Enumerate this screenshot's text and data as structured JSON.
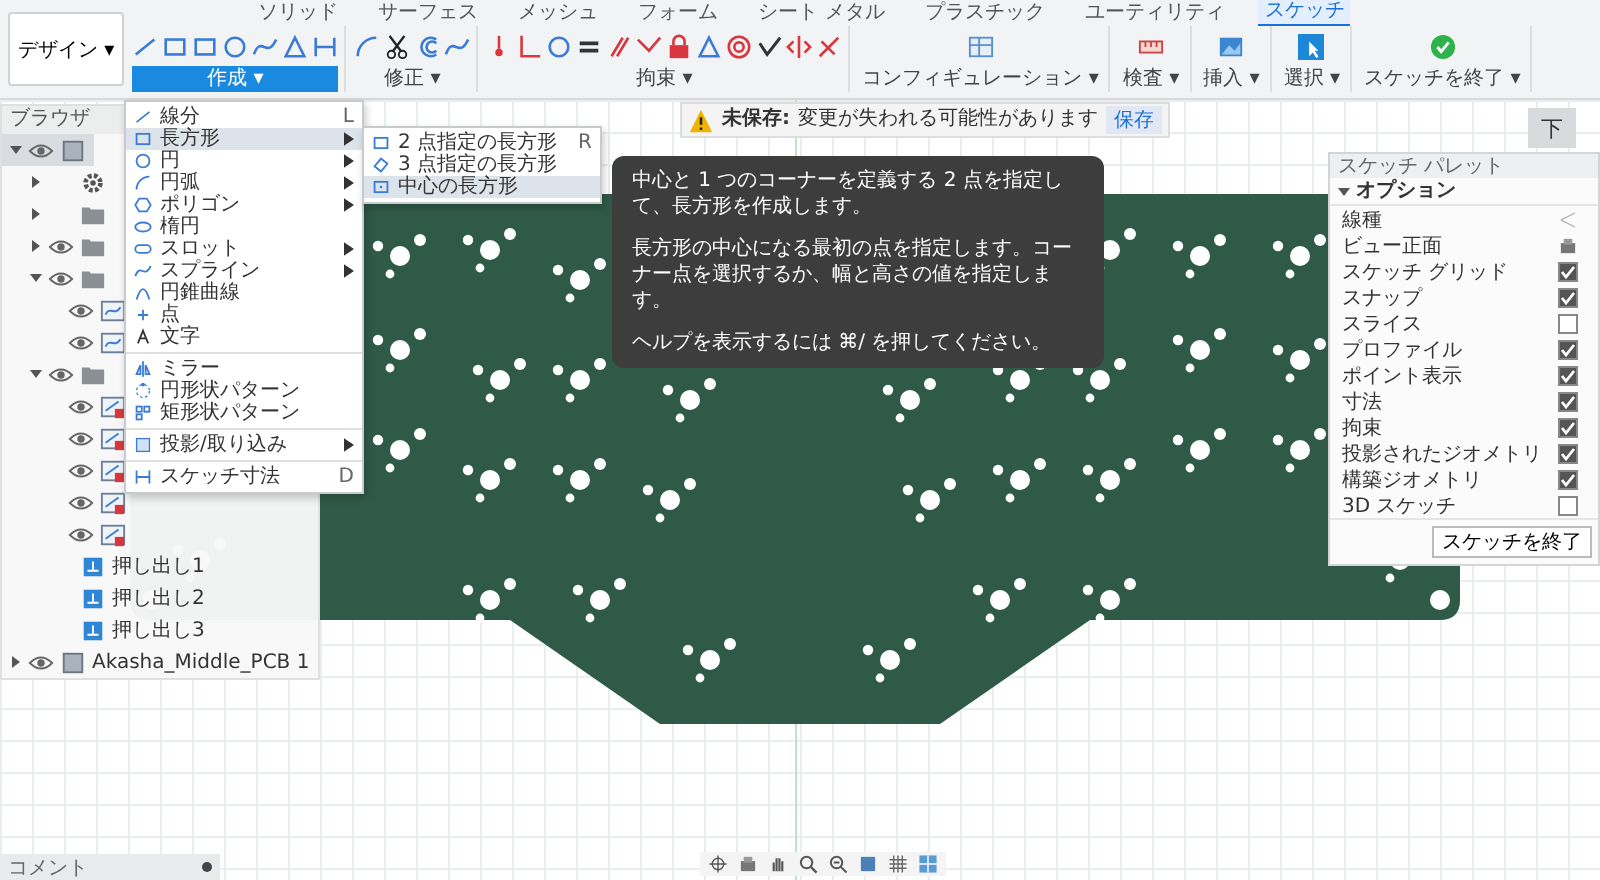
{
  "workspace_button": "デザイン ▾",
  "tabs": [
    {
      "label": "ソリッド",
      "selected": false
    },
    {
      "label": "サーフェス",
      "selected": false
    },
    {
      "label": "メッシュ",
      "selected": false
    },
    {
      "label": "フォーム",
      "selected": false
    },
    {
      "label": "シート メタル",
      "selected": false
    },
    {
      "label": "プラスチック",
      "selected": false
    },
    {
      "label": "ユーティリティ",
      "selected": false
    },
    {
      "label": "スケッチ",
      "selected": true
    }
  ],
  "groups": [
    {
      "label": "作成 ▾",
      "open": true,
      "tools": [
        {
          "kind": "line"
        },
        {
          "kind": "rectangle"
        },
        {
          "kind": "rectangle"
        },
        {
          "kind": "circle"
        },
        {
          "kind": "spline"
        },
        {
          "kind": "triangle"
        },
        {
          "kind": "dimension"
        }
      ]
    },
    {
      "label": "修正 ▾",
      "open": false,
      "tools": [
        {
          "kind": "arc"
        },
        {
          "kind": "scissors"
        },
        {
          "kind": "offset"
        },
        {
          "kind": "spline"
        }
      ]
    },
    {
      "label": "拘束 ▾",
      "open": false,
      "tools": [
        {
          "kind": "coincident"
        },
        {
          "kind": "perpendicular"
        },
        {
          "kind": "circle"
        },
        {
          "kind": "equal"
        },
        {
          "kind": "parallel"
        },
        {
          "kind": "tangent"
        },
        {
          "kind": "lock"
        },
        {
          "kind": "triangle"
        },
        {
          "kind": "concentric"
        },
        {
          "kind": "fix"
        },
        {
          "kind": "symmetric"
        },
        {
          "kind": "curvature"
        }
      ]
    },
    {
      "label": "コンフィギュレーション ▾",
      "open": false,
      "tools": [
        {
          "kind": "config"
        }
      ]
    },
    {
      "label": "検査 ▾",
      "open": false,
      "tools": [
        {
          "kind": "inspect"
        }
      ]
    },
    {
      "label": "挿入 ▾",
      "open": false,
      "tools": [
        {
          "kind": "insert"
        }
      ]
    },
    {
      "label": "選択 ▾",
      "open": false,
      "tools": [
        {
          "kind": "select"
        }
      ]
    },
    {
      "label": "スケッチを終了 ▾",
      "open": false,
      "tools": [
        {
          "kind": "finish"
        }
      ]
    }
  ],
  "notice": {
    "label": "未保存:",
    "text": "変更が失われる可能性があります",
    "button": "保存"
  },
  "browser": {
    "title": "ブラウザ",
    "items": [
      {
        "kind": "component",
        "visible": true,
        "expanded": true,
        "selected": true,
        "children": [
          {
            "kind": "gear",
            "visible": false,
            "expanded": false,
            "selected": false
          },
          {
            "kind": "folder",
            "visible": false,
            "expanded": false,
            "selected": false
          },
          {
            "kind": "folder",
            "visible": true,
            "expanded": false,
            "selected": false
          },
          {
            "kind": "folder",
            "visible": true,
            "expanded": true,
            "selected": false,
            "children": [
              {
                "kind": "sketch",
                "visible": true,
                "selected": false
              },
              {
                "kind": "sketch",
                "visible": true,
                "selected": false
              }
            ]
          },
          {
            "kind": "folder",
            "visible": true,
            "expanded": true,
            "selected": false,
            "children": [
              {
                "kind": "sketch-warning",
                "visible": true,
                "selected": false
              },
              {
                "kind": "sketch-warning",
                "visible": true,
                "selected": false
              },
              {
                "kind": "sketch-warning",
                "visible": true,
                "selected": false
              },
              {
                "kind": "sketch-warning",
                "visible": true,
                "selected": false
              },
              {
                "kind": "sketch-warning",
                "visible": true,
                "selected": false
              }
            ]
          },
          {
            "kind": "extrude",
            "label": "押し出し1",
            "visible": false,
            "selected": false
          },
          {
            "kind": "extrude",
            "label": "押し出し2",
            "visible": false,
            "selected": false
          },
          {
            "kind": "extrude",
            "label": "押し出し3",
            "visible": false,
            "selected": false
          }
        ]
      },
      {
        "kind": "component",
        "label": "Akasha_Middle_PCB 1",
        "visible": true,
        "expanded": false,
        "selected": false
      }
    ]
  },
  "create_menu": [
    [
      {
        "kind": "line",
        "label": "線分",
        "shortcut": "L",
        "submenu": false,
        "highlighted": false
      },
      {
        "kind": "rectangle",
        "label": "長方形",
        "submenu": true,
        "highlighted": true
      },
      {
        "kind": "circle",
        "label": "円",
        "submenu": true,
        "highlighted": false
      },
      {
        "kind": "arc",
        "label": "円弧",
        "submenu": true,
        "highlighted": false
      },
      {
        "kind": "polygon",
        "label": "ポリゴン",
        "submenu": true,
        "highlighted": false
      },
      {
        "kind": "ellipse",
        "label": "楕円",
        "submenu": false,
        "highlighted": false
      },
      {
        "kind": "slot",
        "label": "スロット",
        "submenu": true,
        "highlighted": false
      },
      {
        "kind": "spline",
        "label": "スプライン",
        "submenu": true,
        "highlighted": false
      },
      {
        "kind": "conic",
        "label": "円錐曲線",
        "submenu": false,
        "highlighted": false
      },
      {
        "kind": "point",
        "label": "点",
        "submenu": false,
        "highlighted": false
      },
      {
        "kind": "text",
        "label": "文字",
        "submenu": false,
        "highlighted": false
      }
    ],
    [
      {
        "kind": "mirror",
        "label": "ミラー",
        "submenu": false,
        "highlighted": false
      },
      {
        "kind": "circular-pattern",
        "label": "円形状パターン",
        "submenu": false,
        "highlighted": false
      },
      {
        "kind": "rect-pattern",
        "label": "矩形状パターン",
        "submenu": false,
        "highlighted": false
      }
    ],
    [
      {
        "kind": "project",
        "label": "投影/取り込み",
        "submenu": true,
        "highlighted": false
      }
    ],
    [
      {
        "kind": "dimension",
        "label": "スケッチ寸法",
        "shortcut": "D",
        "submenu": false,
        "highlighted": false
      }
    ]
  ],
  "rectangle_submenu": [
    {
      "kind": "rectangle",
      "label": "2 点指定の長方形",
      "shortcut": "R",
      "highlighted": false
    },
    {
      "kind": "rect-3pt",
      "label": "3 点指定の長方形",
      "highlighted": false
    },
    {
      "kind": "rect-center",
      "label": "中心の長方形",
      "highlighted": true
    }
  ],
  "tooltip": {
    "paragraphs": [
      "中心と 1 つのコーナーを定義する 2 点を指定して、長方形を作成します。",
      "長方形の中心になる最初の点を指定します。コーナー点を選択するか、幅と高さの値を指定します。",
      "ヘルプを表示するには ⌘/ を押してください。"
    ]
  },
  "view_cube": "下",
  "palette": {
    "title": "スケッチ パレット",
    "section": "オプション",
    "expanded": true,
    "rows": [
      {
        "kind": "linetype",
        "label": "線種"
      },
      {
        "kind": "look",
        "label": "ビュー正面"
      },
      {
        "kind": "check",
        "label": "スケッチ グリッド",
        "checked": true
      },
      {
        "kind": "check",
        "label": "スナップ",
        "checked": true
      },
      {
        "kind": "check",
        "label": "スライス",
        "checked": false
      },
      {
        "kind": "check",
        "label": "プロファイル",
        "checked": true
      },
      {
        "kind": "check",
        "label": "ポイント表示",
        "checked": true
      },
      {
        "kind": "check",
        "label": "寸法",
        "checked": true
      },
      {
        "kind": "check",
        "label": "拘束",
        "checked": true
      },
      {
        "kind": "check",
        "label": "投影されたジオメトリ",
        "checked": true
      },
      {
        "kind": "check",
        "label": "構築ジオメトリ",
        "checked": true
      },
      {
        "kind": "check",
        "label": "3D スケッチ",
        "checked": false
      }
    ],
    "button": "スケッチを終了"
  },
  "comments": {
    "title": "コメント"
  },
  "nav_tools": [
    {
      "kind": "orbit"
    },
    {
      "kind": "look"
    },
    {
      "kind": "pan"
    },
    {
      "kind": "zoom"
    },
    {
      "kind": "zoom-window"
    },
    {
      "kind": "display"
    },
    {
      "kind": "grid"
    },
    {
      "kind": "viewports"
    }
  ]
}
